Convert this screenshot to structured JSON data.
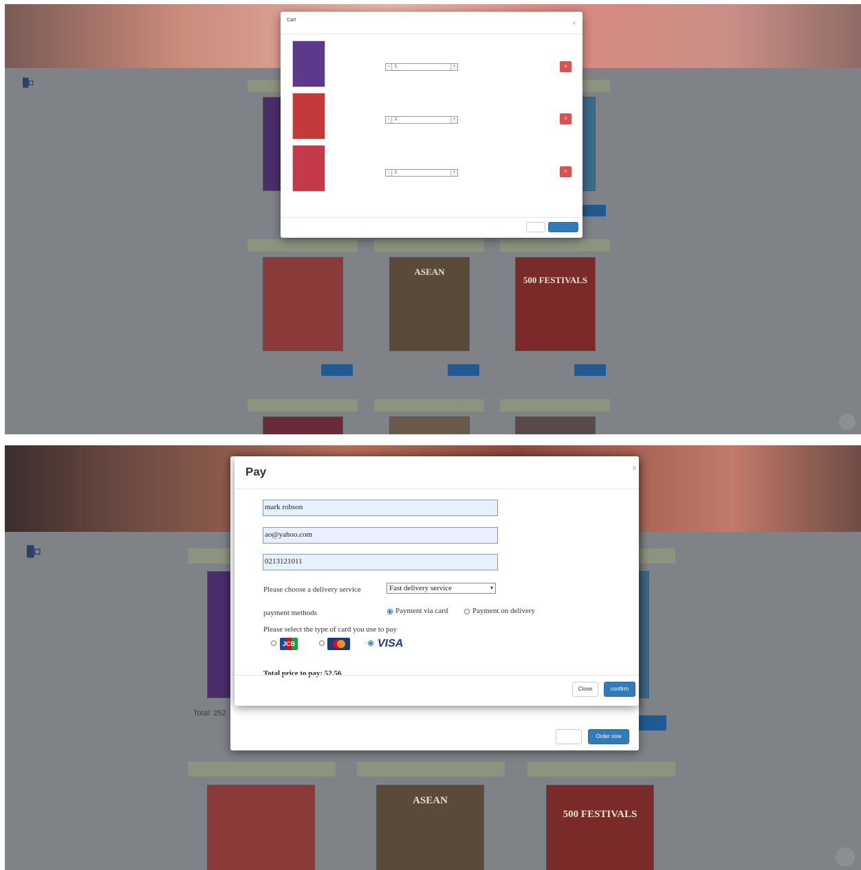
{
  "brand": {
    "logo_text": "█◘"
  },
  "panel1": {
    "product_cards": [
      {
        "head": "",
        "cover_title": "",
        "cover_color": "#4b2d6b",
        "line1": "",
        "line2": ""
      },
      {
        "head": "",
        "cover_title": "",
        "cover_color": "#4b2d6b",
        "line1": "",
        "line2": ""
      },
      {
        "head": "",
        "cover_title": "",
        "cover_color": "#4b2d6b",
        "line1": "",
        "line2": ""
      },
      {
        "head": "",
        "cover_title": "",
        "cover_color": "#8a3a38",
        "line1": "",
        "line2": "",
        "button": ""
      },
      {
        "head": "",
        "cover_title": "ASEAN",
        "cover_color": "#5a4a3a",
        "line1": "",
        "line2": "",
        "button": ""
      },
      {
        "head": "",
        "cover_title": "500 FESTIVALS",
        "cover_color": "#7a2a28",
        "line1": "",
        "line2": "",
        "button": ""
      },
      {
        "head": "",
        "cover_title": "",
        "cover_color": "#6b2a3a"
      },
      {
        "head": "",
        "cover_title": "",
        "cover_color": "#6b5a4a"
      },
      {
        "head": "",
        "cover_title": "",
        "cover_color": "#5a4a4a"
      }
    ]
  },
  "cart": {
    "title": "Cart",
    "items": [
      {
        "price": "",
        "quantity": "1",
        "line_total": "",
        "cover_color": "#5b3a8c",
        "cover_title": ""
      },
      {
        "price": "",
        "quantity": "1",
        "line_total": "",
        "cover_color": "#c43a3a",
        "cover_title": ""
      },
      {
        "price": "",
        "quantity": "1",
        "line_total": "",
        "cover_color": "#c43a4a",
        "cover_title": ""
      }
    ],
    "total": "",
    "close_label": "",
    "order_label": ""
  },
  "panel2": {
    "product_cards": [
      {
        "head": "",
        "cover_title": "",
        "cover_color": "#4b2d6b",
        "line1": "Total: 252",
        "line2": ""
      },
      {
        "head": "",
        "cover_title": "",
        "cover_color": "#4b2d6b"
      },
      {
        "head": "",
        "cover_title": "",
        "cover_color": "#4b2d6b"
      },
      {
        "head": "",
        "cover_title": "",
        "cover_color": "#8a3a38"
      },
      {
        "head": "",
        "cover_title": "ASEAN",
        "cover_color": "#5a4a3a"
      },
      {
        "head": "",
        "cover_title": "500 FESTIVALS",
        "cover_color": "#7a2a28"
      }
    ],
    "cart_total": "",
    "cart_close_label": "",
    "cart_order_label": "Order now"
  },
  "pay": {
    "title": "Pay",
    "name_value": "mark robson",
    "email_value": "ao@yahoo.com",
    "phone_value": "0213121011",
    "delivery_label": "Please choose a delivery service",
    "delivery_selected": "Fast delivery service",
    "payment_methods_label": "payment methods",
    "payment_via_card": "Payment via card",
    "payment_on_delivery": "Payment on delivery",
    "card_type_label": "Please select the type of card you use to pay",
    "cards": [
      "JCB",
      "Mastercard",
      "VISA"
    ],
    "card_jcb_text": "JCB",
    "card_visa_text": "VISA",
    "total_label": "Total price to pay: 52.56",
    "close_label": "Close",
    "confirm_label": "confirm"
  },
  "colors": {
    "primary": "#337ab7",
    "danger": "#d9534f",
    "overlay": "#7f8388"
  }
}
